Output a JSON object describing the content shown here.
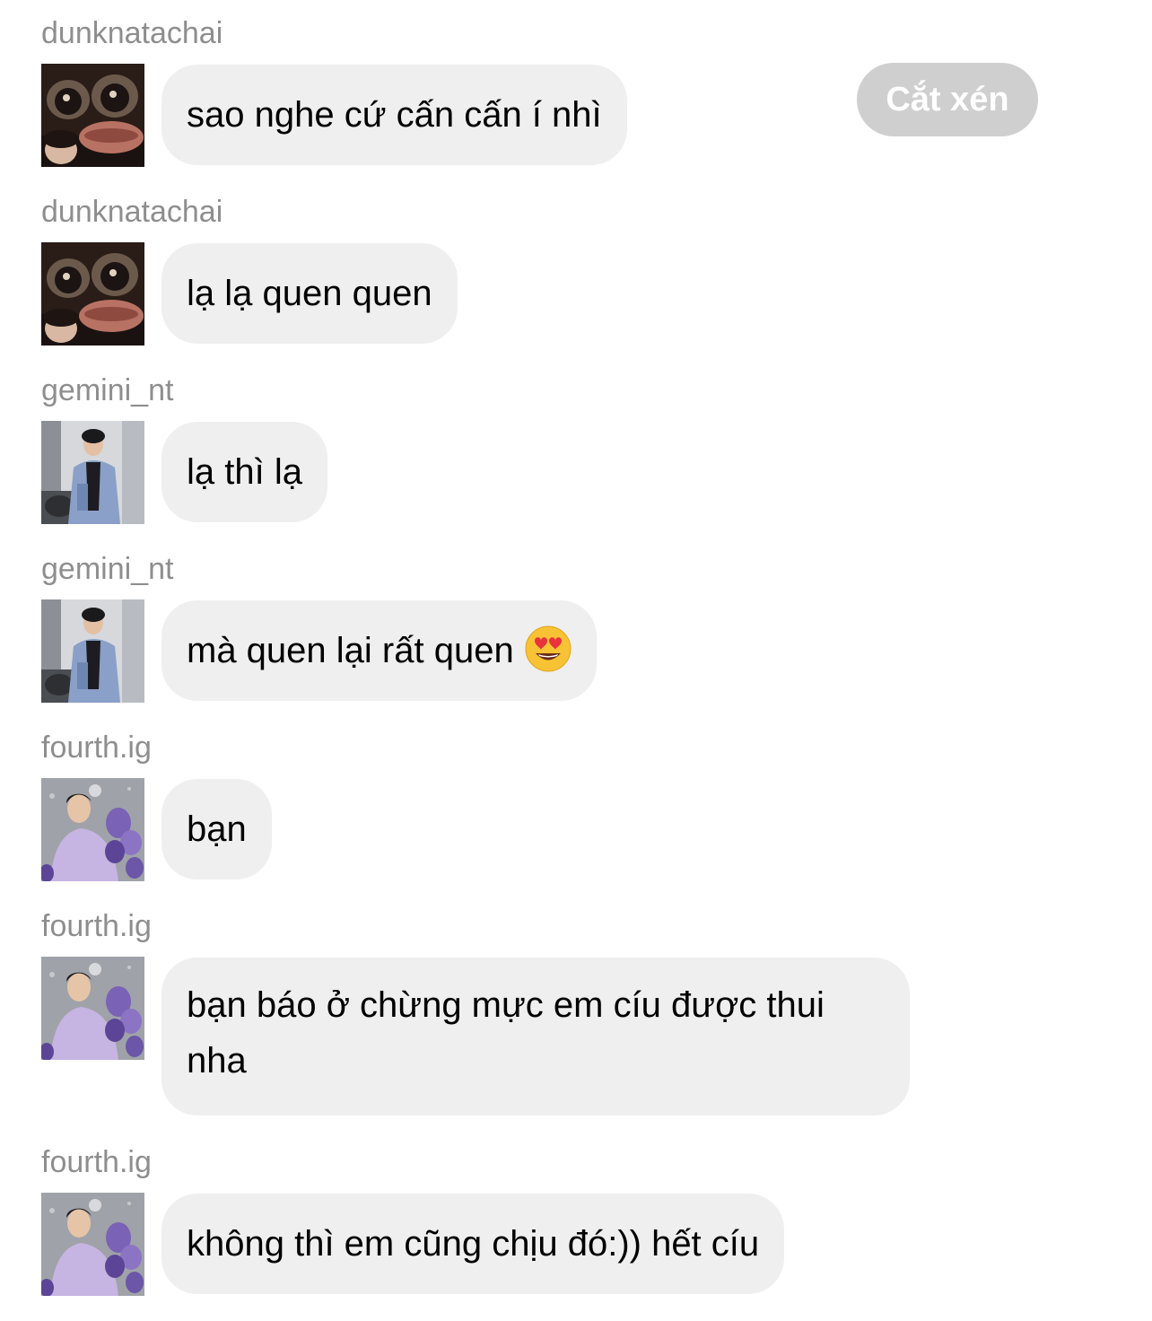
{
  "crop_button_label": "Cắt xén",
  "messages": [
    {
      "username": "dunknatachai",
      "avatar": "avatar-frog-glasses",
      "text": "sao nghe cứ cấn cấn í nhì"
    },
    {
      "username": "dunknatachai",
      "avatar": "avatar-frog-glasses",
      "text": "lạ lạ quen quen"
    },
    {
      "username": "gemini_nt",
      "avatar": "avatar-man-blue-suit",
      "text": "lạ thì lạ"
    },
    {
      "username": "gemini_nt",
      "avatar": "avatar-man-blue-suit",
      "text": "mà quen lại rất quen",
      "emoji": "heart-eyes-emoji"
    },
    {
      "username": "fourth.ig",
      "avatar": "avatar-man-purple-balloons",
      "text": "bạn"
    },
    {
      "username": "fourth.ig",
      "avatar": "avatar-man-purple-balloons",
      "text": "bạn báo ở chừng mực em cíu được thui nha"
    },
    {
      "username": "fourth.ig",
      "avatar": "avatar-man-purple-balloons",
      "text": "không thì em cũng chịu đó:)) hết cíu"
    }
  ]
}
